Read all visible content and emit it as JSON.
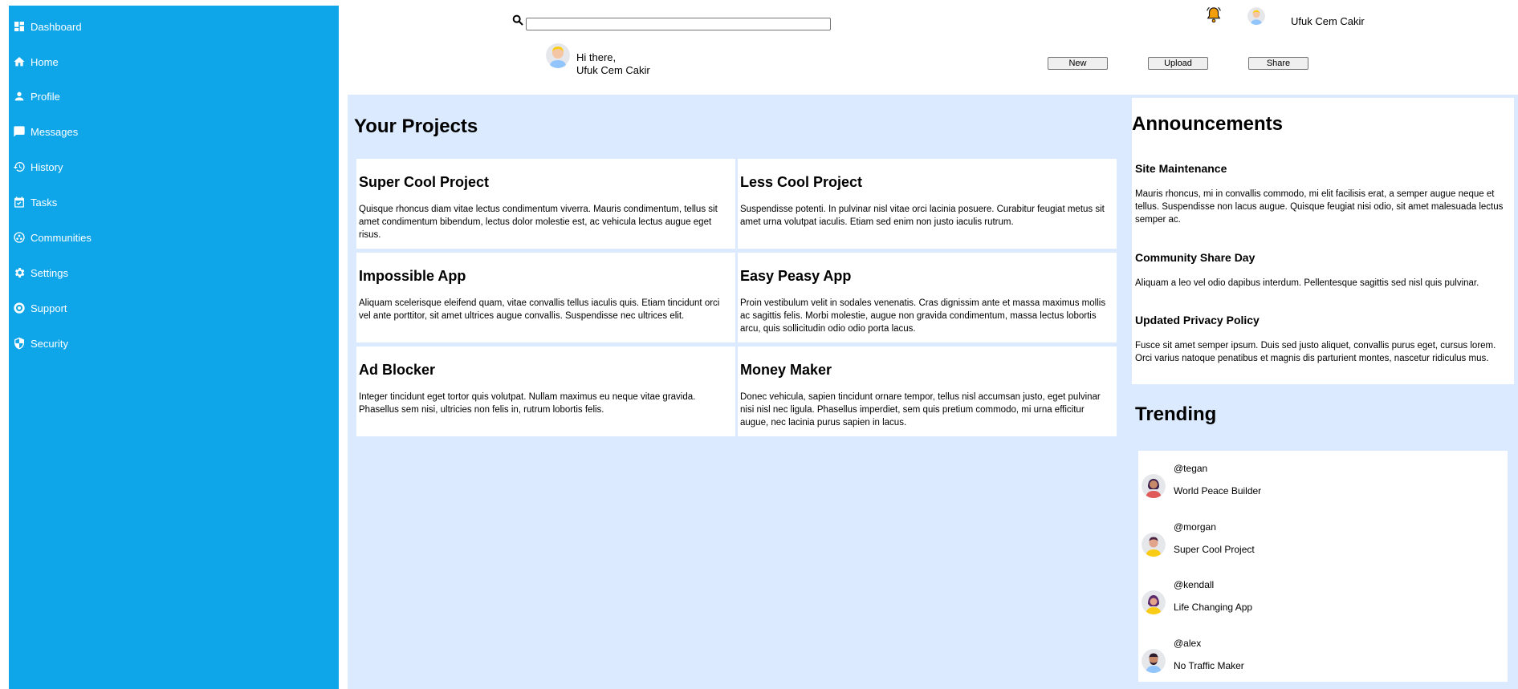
{
  "sidebar": {
    "items": [
      {
        "label": "Dashboard",
        "icon": "dashboard-icon"
      },
      {
        "label": "Home",
        "icon": "home-icon"
      },
      {
        "label": "Profile",
        "icon": "person-icon"
      },
      {
        "label": "Messages",
        "icon": "chat-icon"
      },
      {
        "label": "History",
        "icon": "history-icon"
      },
      {
        "label": "Tasks",
        "icon": "calendar-check-icon"
      },
      {
        "label": "Communities",
        "icon": "communities-icon"
      },
      {
        "label": "Settings",
        "icon": "gear-icon"
      },
      {
        "label": "Support",
        "icon": "support-icon"
      },
      {
        "label": "Security",
        "icon": "shield-icon"
      }
    ],
    "color": "#0ea5e9"
  },
  "header": {
    "search_value": "",
    "user_name": "Ufuk Cem Cakir",
    "greeting_line1": "Hi there,",
    "greeting_line2": "Ufuk Cem Cakir",
    "buttons": {
      "new": "New",
      "upload": "Upload",
      "share": "Share"
    },
    "bell_color": "#f59e0b"
  },
  "projects": {
    "title": "Your Projects",
    "cards": [
      {
        "title": "Super Cool Project",
        "body": "Quisque rhoncus diam vitae lectus condimentum viverra. Mauris condimentum, tellus sit amet condimentum bibendum, lectus dolor molestie est, ac vehicula lectus augue eget risus."
      },
      {
        "title": "Less Cool Project",
        "body": "Suspendisse potenti. In pulvinar nisl vitae orci lacinia posuere. Curabitur feugiat metus sit amet urna volutpat iaculis. Etiam sed enim non justo iaculis rutrum."
      },
      {
        "title": "Impossible App",
        "body": "Aliquam scelerisque eleifend quam, vitae convallis tellus iaculis quis. Etiam tincidunt orci vel ante porttitor, sit amet ultrices augue convallis. Suspendisse nec ultrices elit."
      },
      {
        "title": "Easy Peasy App",
        "body": "Proin vestibulum velit in sodales venenatis. Cras dignissim ante et massa maximus mollis ac sagittis felis. Morbi molestie, augue non gravida condimentum, massa lectus lobortis arcu, quis sollicitudin odio odio porta lacus."
      },
      {
        "title": "Ad Blocker",
        "body": "Integer tincidunt eget tortor quis volutpat. Nullam maximus eu neque vitae gravida. Phasellus sem nisi, ultricies non felis in, rutrum lobortis felis."
      },
      {
        "title": "Money Maker",
        "body": "Donec vehicula, sapien tincidunt ornare tempor, tellus nisl accumsan justo, eget pulvinar nisi nisl nec ligula. Phasellus imperdiet, sem quis pretium commodo, mi urna efficitur augue, nec lacinia purus sapien in lacus."
      }
    ]
  },
  "announcements": {
    "title": "Announcements",
    "items": [
      {
        "title": "Site Maintenance",
        "body": "Mauris rhoncus, mi in convallis commodo, mi elit facilisis erat, a semper augue neque et tellus. Suspendisse non lacus augue. Quisque feugiat nisi odio, sit amet malesuada lectus semper ac."
      },
      {
        "title": "Community Share Day",
        "body": "Aliquam a leo vel odio dapibus interdum. Pellentesque sagittis sed nisl quis pulvinar."
      },
      {
        "title": "Updated Privacy Policy",
        "body": "Fusce sit amet semper ipsum. Duis sed justo aliquet, convallis purus eget, cursus lorem. Orci varius natoque penatibus et magnis dis parturient montes, nascetur ridiculus mus."
      }
    ]
  },
  "trending": {
    "title": "Trending",
    "items": [
      {
        "handle": "@tegan",
        "project": "World Peace Builder"
      },
      {
        "handle": "@morgan",
        "project": "Super Cool Project"
      },
      {
        "handle": "@kendall",
        "project": "Life Changing App"
      },
      {
        "handle": "@alex",
        "project": "No Traffic Maker"
      }
    ]
  },
  "colors": {
    "main_bg": "#dbeafe",
    "card_bg": "#ffffff"
  }
}
